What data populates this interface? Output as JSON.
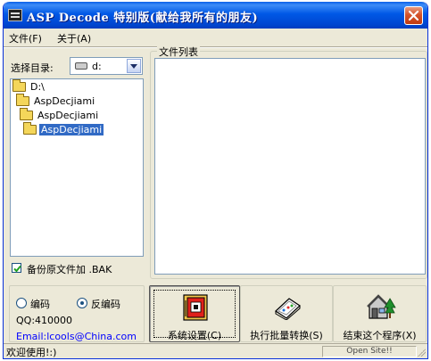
{
  "window": {
    "title": "ASP Decode 特别版(献给我所有的朋友)"
  },
  "menu": {
    "items": [
      "文件(F)",
      "关于(A)"
    ]
  },
  "directory": {
    "label": "选择目录:",
    "drive": "d:"
  },
  "tree": {
    "items": [
      {
        "label": "D:\\",
        "selected": false
      },
      {
        "label": "AspDecjiami",
        "selected": false
      },
      {
        "label": "AspDecjiami",
        "selected": false
      },
      {
        "label": "AspDecjiami",
        "selected": true
      }
    ]
  },
  "backup": {
    "label": "备份原文件加 .BAK",
    "checked": true
  },
  "file_list": {
    "legend": "文件列表"
  },
  "mode": {
    "options": [
      {
        "label": "编码",
        "checked": false
      },
      {
        "label": "反编码",
        "checked": true
      }
    ]
  },
  "contact": {
    "qq": "QQ:410000",
    "email": "Email:lcools@China.com"
  },
  "buttons": {
    "settings": "系统设置(C)",
    "batch": "执行批量转换(S)",
    "exit": "结束这个程序(X)"
  },
  "status": {
    "text": "欢迎使用!:)",
    "site": "Open Site!!"
  },
  "colors": {
    "titlebar": "#0058e6",
    "selection": "#316ac5",
    "face": "#ece9d8",
    "link": "#0000ff"
  }
}
